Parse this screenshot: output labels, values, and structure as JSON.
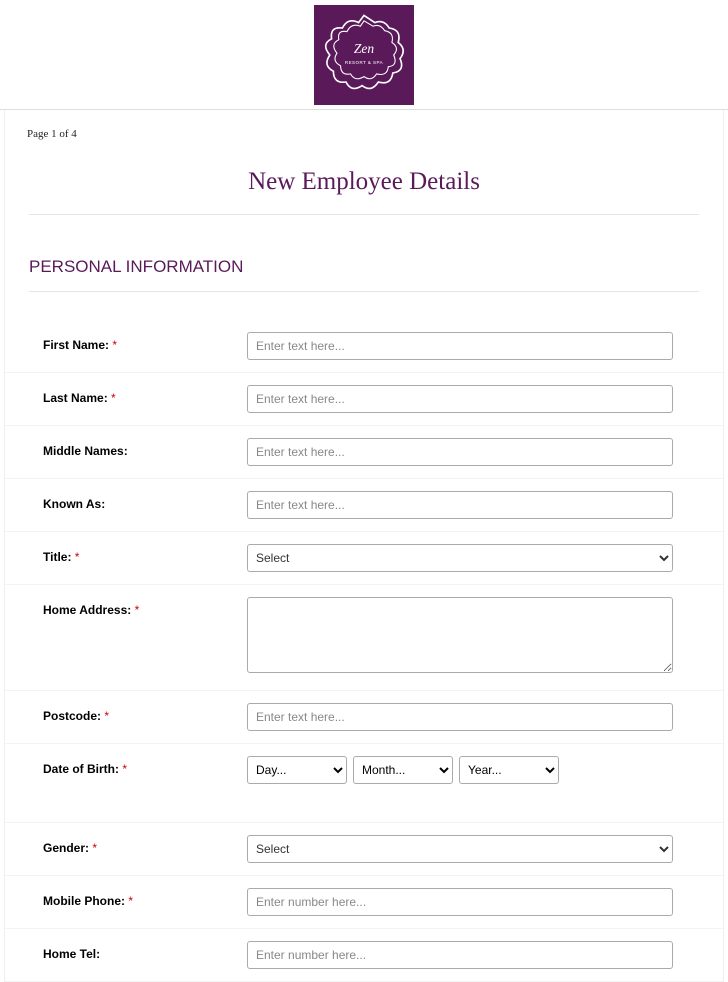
{
  "logo": {
    "brand_text": "Zen",
    "brand_subtext": "RESORT & SPA"
  },
  "page_indicator": "Page 1 of 4",
  "page_title": "New Employee Details",
  "section_heading": "PERSONAL INFORMATION",
  "placeholders": {
    "text": "Enter text here...",
    "number": "Enter number here..."
  },
  "select_default": "Select",
  "dob": {
    "day": "Day...",
    "month": "Month...",
    "year": "Year..."
  },
  "required_marker": "*",
  "fields": {
    "first_name": {
      "label": "First Name:",
      "required": true
    },
    "last_name": {
      "label": "Last Name:",
      "required": true
    },
    "middle_names": {
      "label": "Middle Names:",
      "required": false
    },
    "known_as": {
      "label": "Known As:",
      "required": false
    },
    "title": {
      "label": "Title:",
      "required": true
    },
    "home_address": {
      "label": "Home Address:",
      "required": true
    },
    "postcode": {
      "label": "Postcode:",
      "required": true
    },
    "date_of_birth": {
      "label": "Date of Birth:",
      "required": true
    },
    "gender": {
      "label": "Gender:",
      "required": true
    },
    "mobile_phone": {
      "label": "Mobile Phone:",
      "required": true
    },
    "home_tel": {
      "label": "Home Tel:",
      "required": false
    }
  }
}
